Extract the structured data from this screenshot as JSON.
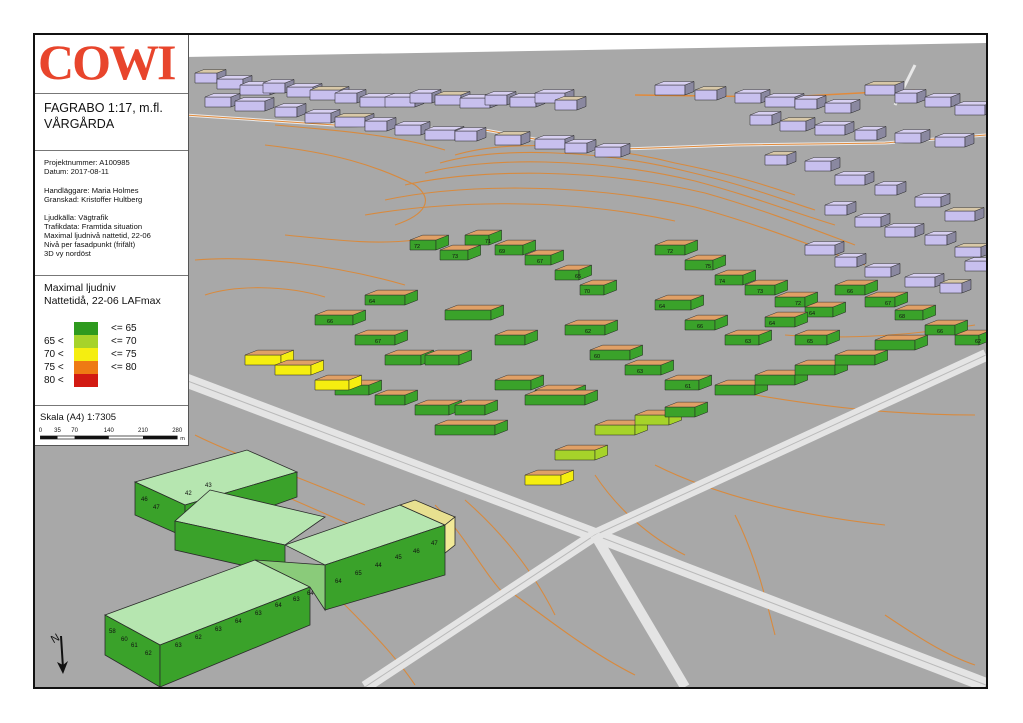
{
  "logo": "COWI",
  "project": {
    "title_line1": "FAGRABO 1:17, m.fl.",
    "title_line2": "VÅRGÅRDA"
  },
  "info": {
    "projektnummer": "Projektnummer: A100985",
    "datum": "Datum: 2017-08-11",
    "handlaggare": "Handläggare: Maria Holmes",
    "granskad": "Granskad: Kristoffer Hultberg",
    "ljudkalla": "Ljudkälla: Vägtrafik",
    "trafikdata": "Trafikdata: Framtida situation",
    "maxniva": "Maximal ljudnivå nattetid, 22-06",
    "niva_fasad": "Nivå per fasadpunkt (frifält)",
    "vy": "3D vy nordöst"
  },
  "legend": {
    "title_line1": "Maximal ljudniv",
    "title_line2": "Nattetidå, 22-06 LAFmax",
    "items": [
      {
        "lo": "",
        "hi": "<= 65",
        "color": "#2e9a1e"
      },
      {
        "lo": "65 <",
        "hi": "<= 70",
        "color": "#a6d32a"
      },
      {
        "lo": "70 <",
        "hi": "<= 75",
        "color": "#f5ee10"
      },
      {
        "lo": "75 <",
        "hi": "<= 80",
        "color": "#ee7a14"
      },
      {
        "lo": "80 <",
        "hi": "",
        "color": "#d21a12"
      }
    ]
  },
  "scale": {
    "label": "Skala (A4) 1:7305",
    "ticks": [
      "0",
      "35",
      "70",
      "140",
      "210",
      "280"
    ],
    "unit": "m"
  },
  "map_colors": {
    "roof": "#e0a066",
    "wall_green": "#3aa22a",
    "wall_lightgreen": "#a6d32a",
    "wall_yellow": "#f5ee10",
    "school_roof": "#b6e6b0",
    "contour": "#d88a3e",
    "road": "#d8d8d8",
    "ground": "#a8a8a8",
    "far_building": "#c8c0ee"
  },
  "school_labels": [
    "58",
    "60",
    "61",
    "62",
    "63",
    "62",
    "63",
    "64",
    "63",
    "64",
    "63",
    "64",
    "64",
    "65",
    "44",
    "45",
    "46",
    "47",
    "46",
    "47",
    "42",
    "43"
  ],
  "building_labels": [
    "72",
    "73",
    "71",
    "69",
    "67",
    "65",
    "70",
    "72",
    "75",
    "74",
    "73",
    "72",
    "64",
    "66",
    "67",
    "68",
    "66",
    "62",
    "64",
    "66",
    "63",
    "64",
    "65",
    "62",
    "60",
    "63",
    "61",
    "64",
    "66",
    "67"
  ]
}
